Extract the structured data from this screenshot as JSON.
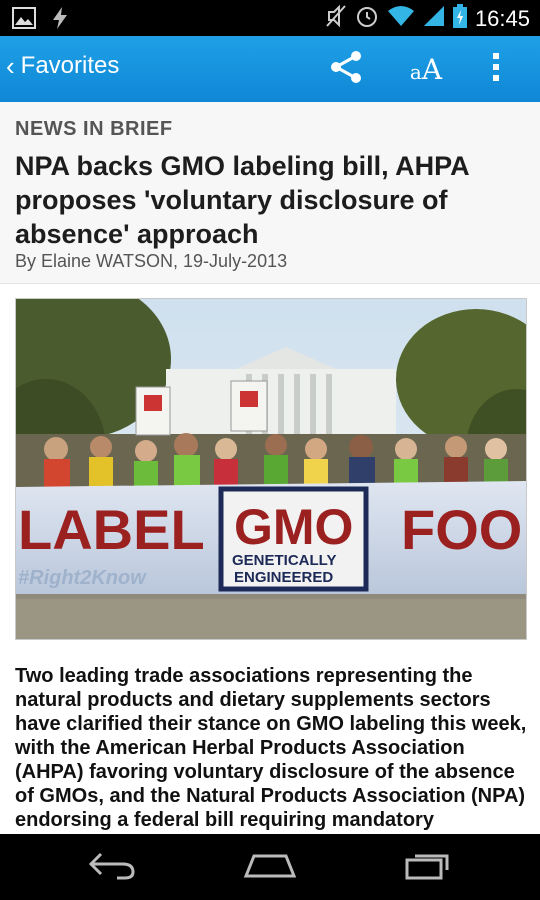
{
  "status_bar": {
    "time": "16:45",
    "icons": [
      "gallery-icon",
      "flash-icon",
      "mute-icon",
      "alarm-icon",
      "wifi-icon",
      "signal-icon",
      "battery-icon"
    ]
  },
  "action_bar": {
    "back_label": "Favorites",
    "back_chevron": "‹",
    "font_size_label_small": "a",
    "font_size_label_large": "A",
    "actions": [
      "share-icon",
      "font-size-icon",
      "overflow-menu-icon"
    ],
    "background": "#1596dd"
  },
  "article": {
    "kicker": "NEWS IN BRIEF",
    "headline": "NPA backs GMO labeling bill, AHPA proposes 'voluntary disclosure of absence' approach",
    "byline": "By Elaine WATSON, 19-July-2013",
    "photo": {
      "banner_text_left": "LABEL",
      "banner_text_center": "GMO",
      "banner_sub_1": "GENETICALLY",
      "banner_sub_2": "ENGINEERED",
      "banner_text_right": "FOO",
      "banner_hashtag": "#Right2Know"
    },
    "body": "Two leading trade associations representing the natural products and dietary supplements sectors have clarified their stance on GMO labeling this week, with the American Herbal Products Association (AHPA) favoring voluntary disclosure of the absence of GMOs, and the Natural Products Association (NPA) endorsing a federal bill requiring mandatory disclosure of GMOs on labels."
  },
  "nav_bar": {
    "buttons": [
      "back-nav-icon",
      "home-nav-icon",
      "recent-apps-nav-icon"
    ]
  }
}
